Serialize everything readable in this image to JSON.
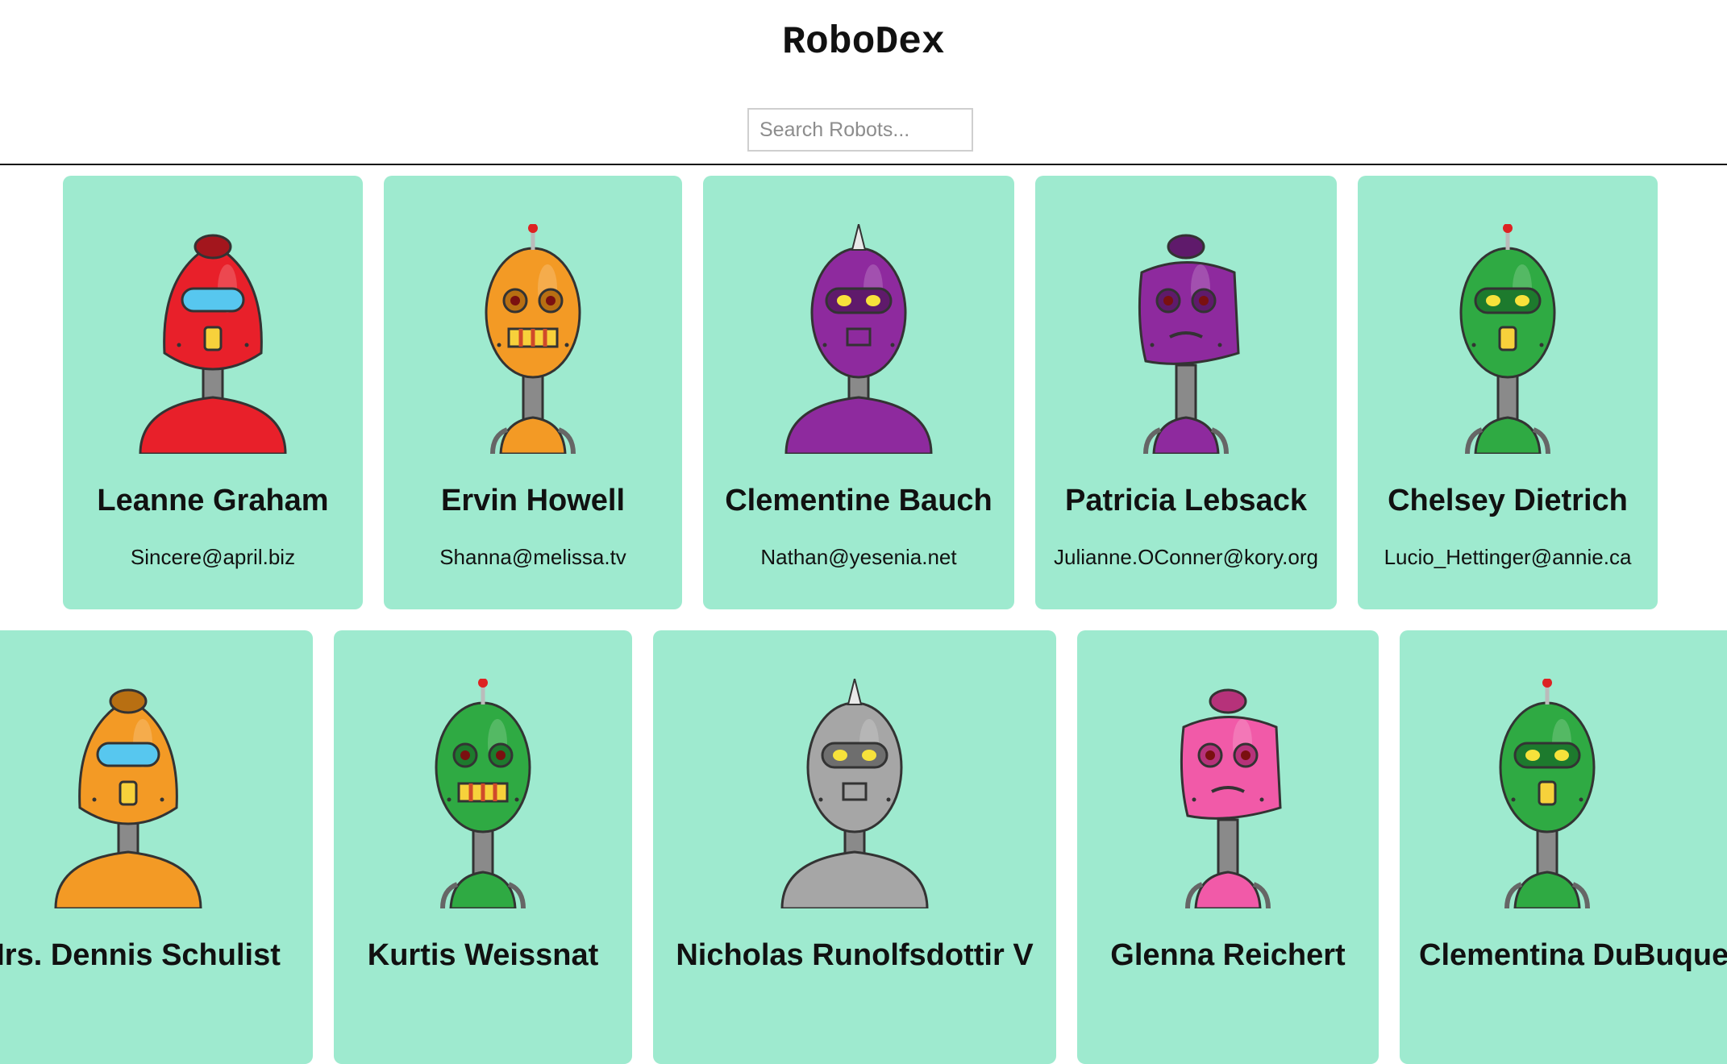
{
  "app": {
    "title": "RoboDex"
  },
  "search": {
    "placeholder": "Search Robots..."
  },
  "robots": [
    {
      "name": "Leanne Graham",
      "email": "Sincere@april.biz",
      "color": "#e8202a",
      "dark": "#a3161d"
    },
    {
      "name": "Ervin Howell",
      "email": "Shanna@melissa.tv",
      "color": "#f39a25",
      "dark": "#b86f12"
    },
    {
      "name": "Clementine Bauch",
      "email": "Nathan@yesenia.net",
      "color": "#8e2a9e",
      "dark": "#5f1a6b"
    },
    {
      "name": "Patricia Lebsack",
      "email": "Julianne.OConner@kory.org",
      "color": "#8e2a9e",
      "dark": "#5f1a6b"
    },
    {
      "name": "Chelsey Dietrich",
      "email": "Lucio_Hettinger@annie.ca",
      "color": "#2faa43",
      "dark": "#1d7a2d"
    },
    {
      "name": "Mrs. Dennis Schulist",
      "email": "",
      "color": "#f39a25",
      "dark": "#b86f12"
    },
    {
      "name": "Kurtis Weissnat",
      "email": "",
      "color": "#2faa43",
      "dark": "#1d7a2d"
    },
    {
      "name": "Nicholas Runolfsdottir V",
      "email": "",
      "color": "#a6a6a6",
      "dark": "#6e6e6e"
    },
    {
      "name": "Glenna Reichert",
      "email": "",
      "color": "#f15aa8",
      "dark": "#b6327a"
    },
    {
      "name": "Clementina DuBuque",
      "email": "",
      "color": "#2faa43",
      "dark": "#1d7a2d"
    }
  ]
}
